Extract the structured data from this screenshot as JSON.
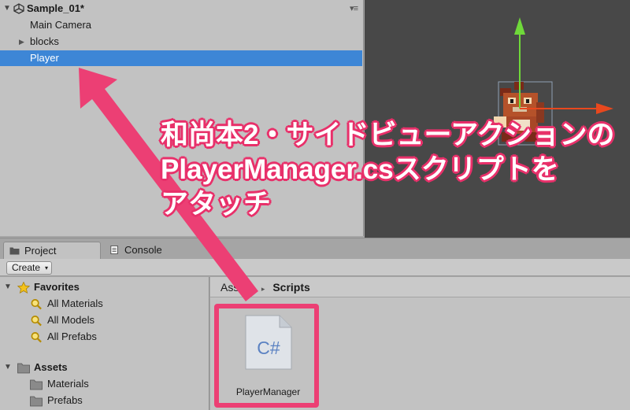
{
  "hierarchy": {
    "scene_name": "Sample_01*",
    "menu_glyph": "▾≡",
    "items": [
      {
        "label": "Main Camera"
      },
      {
        "label": "blocks"
      },
      {
        "label": "Player"
      }
    ]
  },
  "tabs": {
    "project": "Project",
    "console": "Console"
  },
  "toolbar": {
    "create_label": "Create",
    "create_caret": "▾"
  },
  "tree": {
    "favorites": {
      "label": "Favorites",
      "items": [
        {
          "label": "All Materials"
        },
        {
          "label": "All Models"
        },
        {
          "label": "All Prefabs"
        }
      ]
    },
    "assets": {
      "label": "Assets",
      "items": [
        {
          "label": "Materials"
        },
        {
          "label": "Prefabs"
        }
      ]
    }
  },
  "breadcrumb": {
    "root": "Assets",
    "separator": "▸",
    "current": "Scripts"
  },
  "asset": {
    "icon_text": "C#",
    "label": "PlayerManager"
  },
  "annotation": {
    "lines": [
      "和尚本2・サイドビューアクションの",
      "PlayerManager.csスクリプトを",
      "アタッチ"
    ]
  },
  "colors": {
    "selection": "#3d86d6",
    "accent_pink": "#ec3f74",
    "scene_bg": "#484848",
    "gizmo_green": "#6fd93a",
    "gizmo_red": "#e8481e"
  },
  "icons": {
    "scene": "unity-icon",
    "project_tab": "folder-icon",
    "console_tab": "console-icon",
    "favorites": "star-icon",
    "search": "magnifier-icon",
    "folder": "folder-icon",
    "file": "csharp-file-icon"
  }
}
